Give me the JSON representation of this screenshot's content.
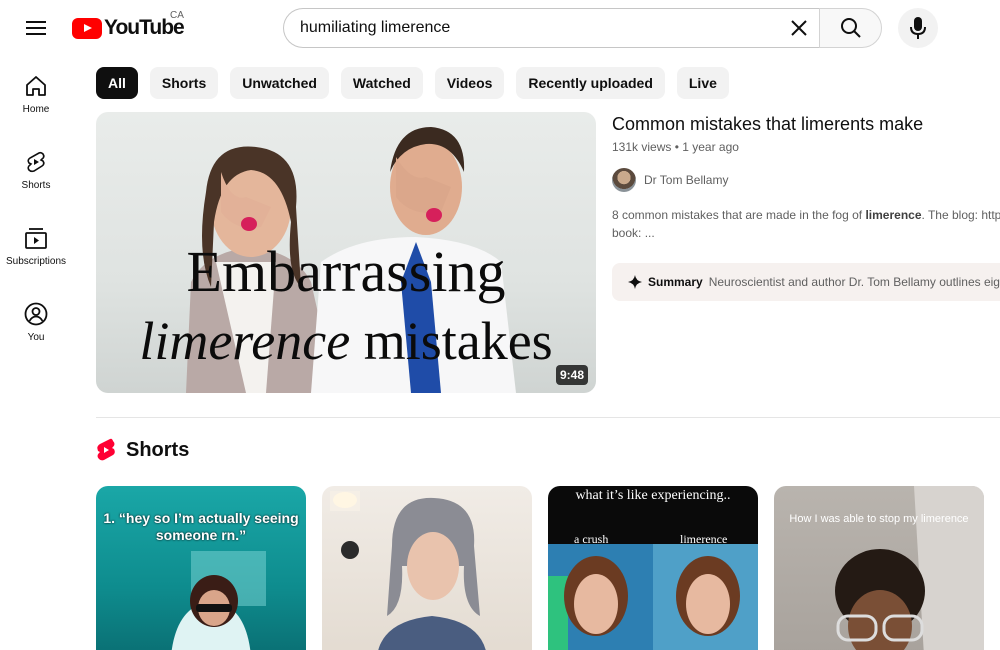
{
  "header": {
    "logo_text": "YouTube",
    "country_code": "CA",
    "search_value": "humiliating limerence",
    "brand_color": "#ff0000"
  },
  "sidebar": {
    "items": [
      {
        "label": "Home",
        "icon": "home-icon"
      },
      {
        "label": "Shorts",
        "icon": "shorts-icon"
      },
      {
        "label": "Subscriptions",
        "icon": "subscriptions-icon"
      },
      {
        "label": "You",
        "icon": "account-icon"
      }
    ]
  },
  "chips": [
    "All",
    "Shorts",
    "Unwatched",
    "Watched",
    "Videos",
    "Recently uploaded",
    "Live"
  ],
  "video": {
    "thumb_line1": "Embarrassing",
    "thumb_line2_italic": "limerence",
    "thumb_line2_rest": " mistakes",
    "duration": "9:48",
    "title": "Common mistakes that limerents make",
    "meta": "131k views • 1 year ago",
    "channel": "Dr Tom Bellamy",
    "desc_pre": "8 common mistakes that are made in the fog of ",
    "desc_bold": "limerence",
    "desc_post": ". The blog: http",
    "desc_line2": "book: ...",
    "summary_label": "Summary",
    "summary_text": "Neuroscientist and author Dr. Tom Bellamy outlines eigh"
  },
  "shorts": {
    "title": "Shorts",
    "cards": [
      {
        "caption": "1. “hey so I’m actually seeing someone rn.”"
      },
      {
        "caption": ""
      },
      {
        "caption": "what it’s like experiencing..",
        "left_label": "a crush",
        "right_label": "limerence"
      },
      {
        "caption": "How I was able to stop my limerence"
      }
    ]
  }
}
